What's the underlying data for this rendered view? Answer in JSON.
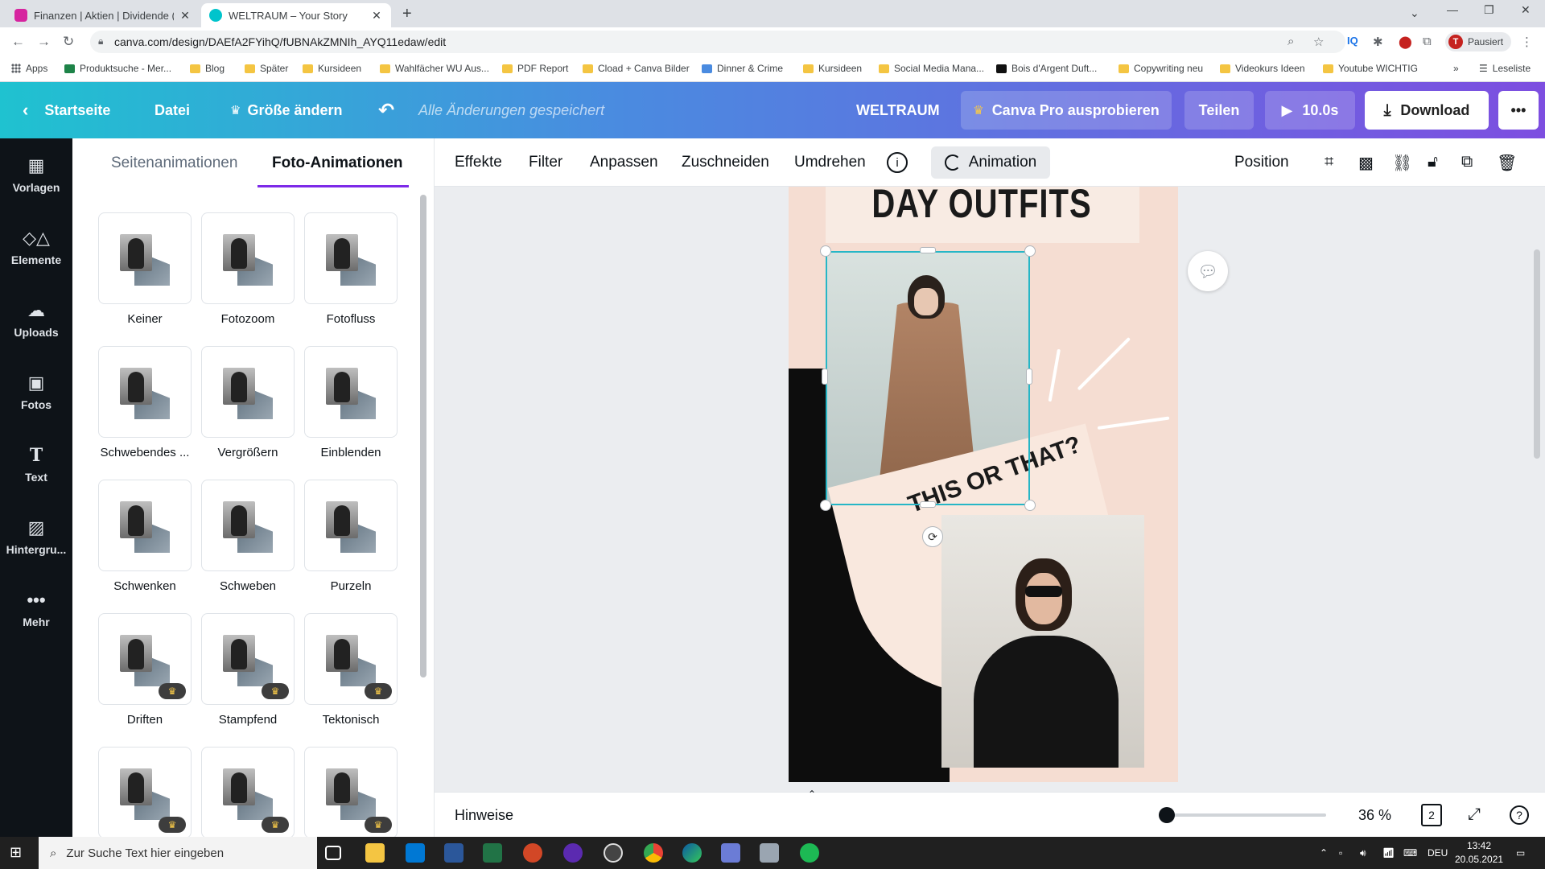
{
  "browser": {
    "tabs": [
      {
        "title": "Finanzen | Aktien | Dividende (@",
        "active": false,
        "color": "#d6249f"
      },
      {
        "title": "WELTRAUM – Your Story",
        "active": true,
        "color": "#00c4cc"
      }
    ],
    "url": "canva.com/design/DAEfA2FYihQ/fUBNAkZMNIh_AYQ11edaw/edit",
    "profile_label": "Pausiert",
    "profile_initial": "T"
  },
  "bookmarks": [
    "Apps",
    "Produktsuche - Mer...",
    "Blog",
    "Später",
    "Kursideen",
    "Wahlfächer WU Aus...",
    "PDF Report",
    "Cload + Canva Bilder",
    "Dinner & Crime",
    "Kursideen",
    "Social Media Mana...",
    "Bois d'Argent Duft...",
    "Copywriting neu",
    "Videokurs Ideen",
    "Youtube WICHTIG"
  ],
  "reading_list": "Leseliste",
  "canva_bar": {
    "home": "Startseite",
    "file": "Datei",
    "resize": "Größe ändern",
    "saved": "Alle Änderungen gespeichert",
    "design_title": "WELTRAUM",
    "pro": "Canva Pro ausprobieren",
    "share": "Teilen",
    "play": "10.0s",
    "download": "Download",
    "more": "•••"
  },
  "rail": [
    {
      "label": "Vorlagen",
      "icon": "templates-icon"
    },
    {
      "label": "Elemente",
      "icon": "elements-icon"
    },
    {
      "label": "Uploads",
      "icon": "upload-icon"
    },
    {
      "label": "Fotos",
      "icon": "photos-icon"
    },
    {
      "label": "Text",
      "icon": "text-icon"
    },
    {
      "label": "Hintergru...",
      "icon": "background-icon"
    },
    {
      "label": "Mehr",
      "icon": "more-icon"
    }
  ],
  "panel": {
    "tab_page": "Seitenanimationen",
    "tab_photo": "Foto-Animationen",
    "animations": [
      {
        "label": "Keiner",
        "pro": false
      },
      {
        "label": "Fotozoom",
        "pro": false
      },
      {
        "label": "Fotofluss",
        "pro": false
      },
      {
        "label": "Schwebendes ...",
        "pro": false
      },
      {
        "label": "Vergrößern",
        "pro": false
      },
      {
        "label": "Einblenden",
        "pro": false
      },
      {
        "label": "Schwenken",
        "pro": false
      },
      {
        "label": "Schweben",
        "pro": false
      },
      {
        "label": "Purzeln",
        "pro": false
      },
      {
        "label": "Driften",
        "pro": true
      },
      {
        "label": "Stampfend",
        "pro": true
      },
      {
        "label": "Tektonisch",
        "pro": true
      },
      {
        "label": "",
        "pro": true
      },
      {
        "label": "",
        "pro": true
      },
      {
        "label": "",
        "pro": true
      }
    ]
  },
  "toolbar": {
    "effects": "Effekte",
    "filter": "Filter",
    "adjust": "Anpassen",
    "crop": "Zuschneiden",
    "flip": "Umdrehen",
    "animation": "Animation",
    "position": "Position"
  },
  "design": {
    "headline": "DAY OUTFITS",
    "tagline": "THIS OR THAT?"
  },
  "bottom": {
    "notes": "Hinweise",
    "zoom": "36 %",
    "zoom_level": 0.04,
    "pages": "2"
  },
  "taskbar": {
    "search_placeholder": "Zur Suche Text hier eingeben",
    "language": "DEU",
    "time": "13:42",
    "date": "20.05.2021"
  }
}
